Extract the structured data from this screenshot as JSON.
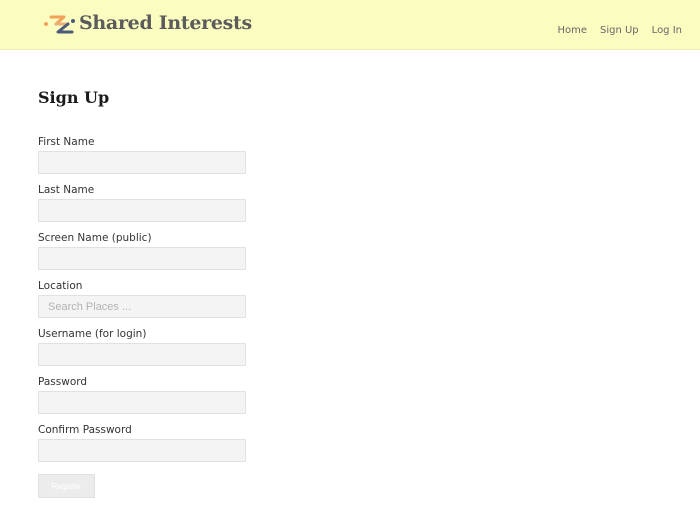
{
  "header": {
    "brand": "Shared Interests",
    "logo_icon": "shared-interests-logo-icon",
    "colors": {
      "background": "#fbfcc0",
      "logo_orange": "#f0a25a",
      "logo_slate": "#4b5a78"
    },
    "nav": [
      {
        "label": "Home"
      },
      {
        "label": "Sign Up"
      },
      {
        "label": "Log In"
      }
    ]
  },
  "page": {
    "title": "Sign Up"
  },
  "form": {
    "fields": [
      {
        "label": "First Name",
        "value": "",
        "placeholder": ""
      },
      {
        "label": "Last Name",
        "value": "",
        "placeholder": ""
      },
      {
        "label": "Screen Name (public)",
        "value": "",
        "placeholder": ""
      },
      {
        "label": "Location",
        "value": "",
        "placeholder": "Search Places ..."
      },
      {
        "label": "Username (for login)",
        "value": "",
        "placeholder": ""
      },
      {
        "label": "Password",
        "value": "",
        "placeholder": ""
      },
      {
        "label": "Confirm Password",
        "value": "",
        "placeholder": ""
      }
    ],
    "submit_label": "Register"
  }
}
